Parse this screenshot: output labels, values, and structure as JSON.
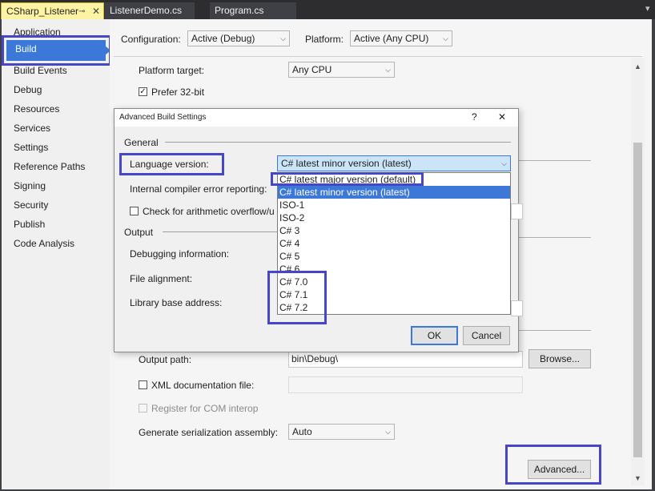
{
  "tabs": [
    {
      "label": "CSharp_Listener",
      "pin": "⊸",
      "close": "✕"
    },
    {
      "label": "ListenerDemo.cs"
    },
    {
      "label": "Program.cs"
    }
  ],
  "tab_overflow": "▾",
  "sidebar": {
    "items": [
      "Application",
      "Build",
      "Build Events",
      "Debug",
      "Resources",
      "Services",
      "Settings",
      "Reference Paths",
      "Signing",
      "Security",
      "Publish",
      "Code Analysis"
    ]
  },
  "config": {
    "configuration_label": "Configuration:",
    "configuration_value": "Active (Debug)",
    "platform_label": "Platform:",
    "platform_value": "Active (Any CPU)"
  },
  "build": {
    "platform_target_label": "Platform target:",
    "platform_target_value": "Any CPU",
    "prefer32_label": "Prefer 32-bit",
    "output_path_label": "Output path:",
    "output_path_value": "bin\\Debug\\",
    "browse_label": "Browse...",
    "xml_doc_label": "XML documentation file:",
    "register_com_label": "Register for COM interop",
    "gen_serial_label": "Generate serialization assembly:",
    "gen_serial_value": "Auto",
    "advanced_label": "Advanced..."
  },
  "dialog": {
    "title": "Advanced Build Settings",
    "help": "?",
    "close": "✕",
    "general_header": "General",
    "language_version_label": "Language version:",
    "language_version_value": "C# latest minor version (latest)",
    "ice_label": "Internal compiler error reporting:",
    "overflow_label": "Check for arithmetic overflow/u",
    "output_header": "Output",
    "debug_info_label": "Debugging information:",
    "file_alignment_label": "File alignment:",
    "library_base_label": "Library base address:",
    "ok_label": "OK",
    "cancel_label": "Cancel",
    "options": [
      "C# latest major version (default)",
      "C# latest minor version (latest)",
      "ISO-1",
      "ISO-2",
      "C# 3",
      "C# 4",
      "C# 5",
      "C# 6",
      "C# 7.0",
      "C# 7.1",
      "C# 7.2"
    ],
    "selected_index": 1
  },
  "colors": {
    "accent": "#3c78d8",
    "highlight_box": "#4646c8",
    "active_tab": "#fcf4a3",
    "tab_bar": "#2d2d30"
  }
}
